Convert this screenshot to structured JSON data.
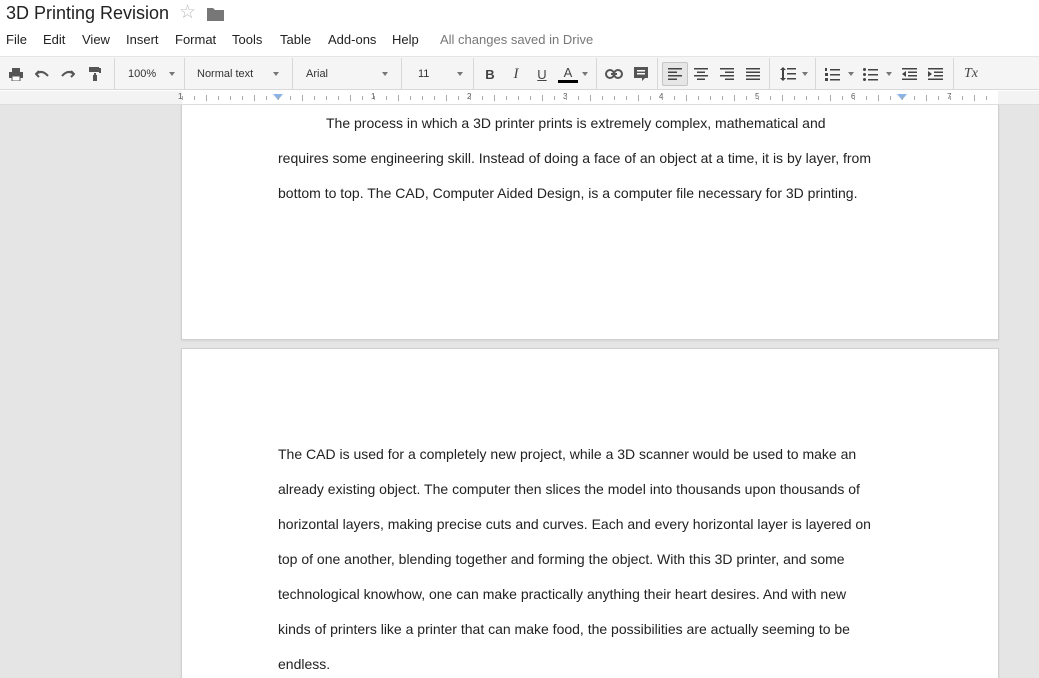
{
  "doc": {
    "title": "3D Printing Revision",
    "save_status": "All changes saved in Drive"
  },
  "menu": [
    "File",
    "Edit",
    "View",
    "Insert",
    "Format",
    "Tools",
    "Table",
    "Add-ons",
    "Help"
  ],
  "toolbar": {
    "zoom": "100%",
    "style": "Normal text",
    "font": "Arial",
    "size": "11",
    "bold": "B",
    "italic": "I",
    "underline": "U",
    "text_color": "A",
    "clear_format": "Tx"
  },
  "ruler": {
    "numbers": [
      "1",
      "1",
      "2",
      "3",
      "4",
      "5",
      "6",
      "7"
    ]
  },
  "page1": {
    "lines": [
      "The process in which a 3D printer prints is extremely complex, mathematical and",
      "requires some engineering skill. Instead of doing a face of an object at a time, it is by layer, from",
      "bottom to top. The CAD, Computer Aided Design, is a computer file necessary for 3D printing."
    ]
  },
  "page2": {
    "lines": [
      "The CAD is used for a completely new project, while a 3D scanner would be used to make an",
      "already existing object. The computer then slices the model into thousands upon thousands of",
      "horizontal layers, making precise cuts and curves. Each and every horizontal layer is layered on",
      "top of one another, blending together and forming the object. With this 3D printer, and some",
      "technological knowhow, one can make practically anything their heart desires. And with new",
      "kinds of printers like a printer that can make food, the possibilities are actually seeming to be",
      "endless."
    ]
  },
  "colors": {
    "accent": "#8ab4e5",
    "canvas": "#e5e5e5",
    "toolbar": "#f5f5f5"
  }
}
